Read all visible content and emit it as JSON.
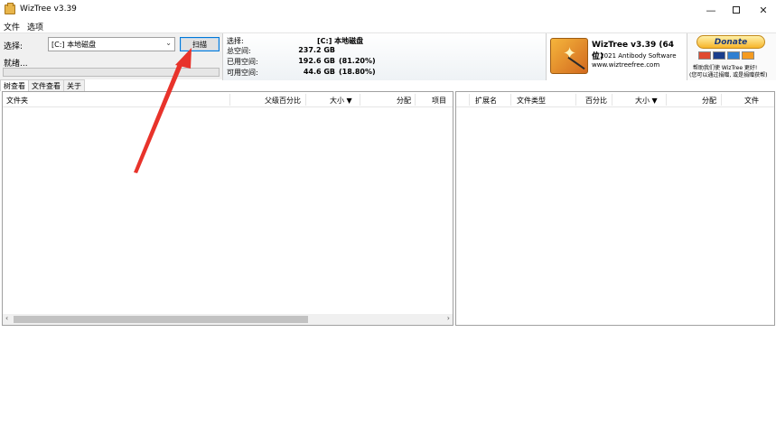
{
  "window": {
    "title": "WizTree v3.39",
    "controls": {
      "minimize": "—",
      "close": "✕"
    }
  },
  "menu": [
    "文件",
    "选项"
  ],
  "selector": {
    "label": "选择:",
    "drive_value": "[C:] 本地磁盘",
    "scan_label": "扫描",
    "status_label": "就绪..."
  },
  "info": {
    "select_label": "选择:",
    "select_value": "[C:]  本地磁盘",
    "total_label": "总空间:",
    "total_value": "237.2 GB",
    "used_label": "已用空间:",
    "used_value": "192.6 GB",
    "used_pct": "(81.20%)",
    "free_label": "可用空间:",
    "free_value": "44.6 GB",
    "free_pct": "(18.80%)"
  },
  "brand": {
    "title": "WizTree v3.39 (64 位)",
    "copyright": "© 2021 Antibody Software",
    "url": "www.wiztreefree.com"
  },
  "donate": {
    "button": "Donate",
    "text1": "帮助我们使 WizTree 更好!",
    "text2": "(您可以通过捐赠, 或是捐赠获帮)"
  },
  "tabs": [
    "树查看",
    "文件查看",
    "关于"
  ],
  "left_table": {
    "columns": [
      "文件夹",
      "父级百分比",
      "大小 ▼",
      "分配",
      "项目"
    ]
  },
  "right_table": {
    "columns": [
      "扩展名",
      "文件类型",
      "百分比",
      "大小 ▼",
      "分配",
      "文件"
    ]
  },
  "colors": {
    "annotation": "#e8332b",
    "accent": "#0078d7"
  }
}
